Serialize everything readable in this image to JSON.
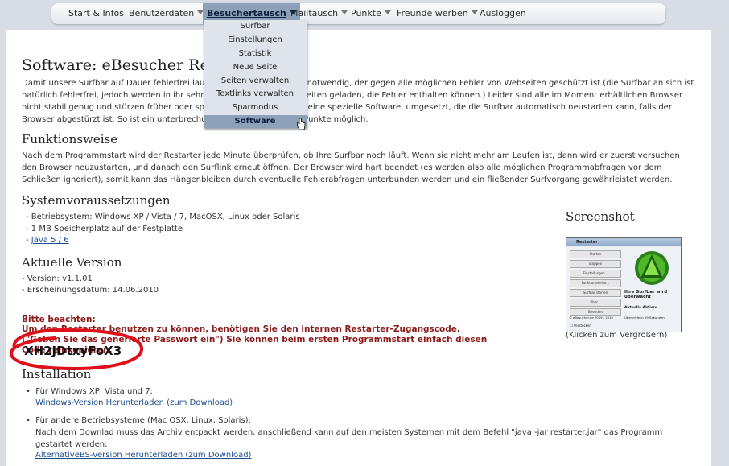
{
  "nav": {
    "items": [
      {
        "label": "Start & Infos"
      },
      {
        "label": "Benutzerdaten"
      },
      {
        "label": "Besuchertausch"
      },
      {
        "label": "Mailtausch"
      },
      {
        "label": "Punkte"
      },
      {
        "label": "Freunde werben"
      },
      {
        "label": "Ausloggen"
      }
    ],
    "dropdown": [
      "Surfbar",
      "Einstellungen",
      "Statistik",
      "Neue Seite",
      "Seiten verwalten",
      "Textlinks verwalten",
      "Sparmodus",
      "Software"
    ]
  },
  "page": {
    "title": "Software: eBesucher Restarter",
    "intro": "Damit unsere Surfbar auf Dauer fehlerfrei laufen kann, ist ein Browser notwendig, der gegen alle möglichen Fehler von Webseiten geschützt ist (die Surfbar an sich ist natürlich fehlerfrei, jedoch werden in ihr sehr viele verschiedene Webseiten geladen, die Fehler enthalten können.) Leider sind alle im Moment erhältlichen Browser nicht stabil genug und stürzen früher oder später ab. Daher haben wir eine spezielle Software, umgesetzt, die die Surfbar automatisch neustarten kann, falls der Browser abgestürzt ist. So ist ein unterbrechungsfreies Sammeln von Punkte möglich.",
    "funktion_heading": "Funktionsweise",
    "funktion_text": "Nach dem Programmstart wird der Restarter jede Minute überprüfen, ob Ihre Surfbar noch läuft. Wenn sie nicht mehr am Laufen ist, dann wird er zuerst versuchen den Browser neuzustarten, und danach den Surflink erneut öffnen. Der Browser wird hart beendet (es werden also alle möglichen Programmabfragen vor dem Schließen ignoriert), somit kann das Hängenbleiben durch eventuelle Fehlerabfragen unterbunden werden und ein fließender Surfvorgang gewährleistet werden.",
    "sys_heading": "Systemvoraussetzungen",
    "sys_items": [
      "- Betriebsystem: Windows XP / Vista / 7, MacOSX, Linux oder Solaris",
      "- 1 MB Speicherplatz auf der Festplatte",
      "- "
    ],
    "sys_link": "Java 5 / 6",
    "version_heading": "Aktuelle Version",
    "version_items": [
      "- Version: v1.1.01",
      "- Erscheinungsdatum: 14.06.2010"
    ],
    "warn_title": "Bitte beachten:",
    "warn_text": "Um den Restarter benutzen zu können, benötigen Sie den internen Restarter-Zugangscode. (\"Geben Sie das generierte Passwort ein\") Sie können beim ersten Programmstart einfach diesen Code reinkopieren:",
    "code": "XH2JDtxyFoX3",
    "install_heading": "Installation",
    "install_win_label": "Für Windows XP, Vista und 7:",
    "install_win_link": "Windows-Version Herunterladen (zum Download)",
    "install_other_label": "Für andere Betriebsysteme (Mac OSX, Linux, Solaris):",
    "install_other_text": "Nach dem Downlad muss das Archiv entpackt werden, anschließend kann auf den meisten Systemen mit dem Befehl \"java -jar restarter.jar\" das Programm gestartet werden:",
    "install_other_link": "AlternativeBS-Version Herunterladen (zum Download)",
    "screenshot_heading": "Screenshot",
    "screenshot_caption": "(Klicken zum Vergrößern)"
  },
  "thumbnail": {
    "window_title": "Restarter",
    "buttons": [
      "Starten",
      "Stoppen",
      "Einstellungen...",
      "Funktionsweise...",
      "Surfbar starten",
      "Über...",
      "Beenden"
    ],
    "status": "Ihre Surfbar wird überwacht",
    "action": "Aktuelle Aktion:",
    "footer": "© eBesucher.de 2009 - 2010",
    "check": "Überprüfe in 59 Sekunden",
    "checkbox": "Verstecken"
  },
  "colors": {
    "accent": "#8da2b8",
    "warn": "#8b1a1a",
    "link": "#1e4d8f",
    "circle": "#e0101a"
  }
}
